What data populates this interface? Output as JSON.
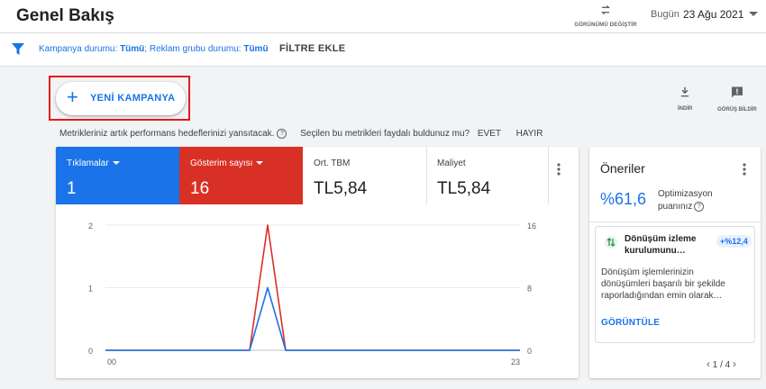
{
  "header": {
    "title": "Genel Bakış",
    "view_toggle_label": "GÖRÜNÜMÜ DEĞİŞTİR",
    "date_label": "Bugün",
    "date_value": "23 Ağu 2021"
  },
  "filters": {
    "campaign_status_label": "Kampanya durumu:",
    "campaign_status_value": "Tümü",
    "adgroup_status_label": "Reklam grubu durumu:",
    "adgroup_status_value": "Tümü",
    "add_filter": "FİLTRE EKLE"
  },
  "actions": {
    "new_campaign": "YENİ KAMPANYA",
    "download": "İNDİR",
    "feedback": "GÖRÜŞ BİLDİR"
  },
  "metrics_note": {
    "text": "Metrikleriniz artık performans hedeflerinizi yansıtacak.",
    "question": "Seçilen bu metrikleri faydalı buldunuz mu?",
    "yes": "EVET",
    "no": "HAYIR"
  },
  "tiles": [
    {
      "label": "Tıklamalar",
      "value": "1",
      "color": "#1a73e8"
    },
    {
      "label": "Gösterim sayısı",
      "value": "16",
      "color": "#d93025"
    },
    {
      "label": "Ort. TBM",
      "value": "TL5,84"
    },
    {
      "label": "Maliyet",
      "value": "TL5,84"
    }
  ],
  "chart_data": {
    "type": "line",
    "x": [
      0,
      1,
      2,
      3,
      4,
      5,
      6,
      7,
      8,
      9,
      10,
      11,
      12,
      13,
      14,
      15,
      16,
      17,
      18,
      19,
      20,
      21,
      22,
      23
    ],
    "x_tick_labels": [
      "00",
      "23"
    ],
    "series": [
      {
        "name": "Tıklamalar",
        "axis": "left",
        "color": "#1a73e8",
        "values": [
          0,
          0,
          0,
          0,
          0,
          0,
          0,
          0,
          0,
          1,
          0,
          0,
          0,
          0,
          0,
          0,
          0,
          0,
          0,
          0,
          0,
          0,
          0,
          0
        ]
      },
      {
        "name": "Gösterim sayısı",
        "axis": "right",
        "color": "#d93025",
        "values": [
          0,
          0,
          0,
          0,
          0,
          0,
          0,
          0,
          0,
          16,
          0,
          0,
          0,
          0,
          0,
          0,
          0,
          0,
          0,
          0,
          0,
          0,
          0,
          0
        ]
      }
    ],
    "left_axis": {
      "ylim": [
        0,
        2
      ],
      "ticks": [
        "0",
        "1",
        "2"
      ]
    },
    "right_axis": {
      "ylim": [
        0,
        16
      ],
      "ticks": [
        "0",
        "8",
        "16"
      ]
    },
    "grid": true,
    "title": "",
    "xlabel": "",
    "ylabel": ""
  },
  "recommendations": {
    "title": "Öneriler",
    "score": "%61,6",
    "score_label": "Optimizasyon puanınız",
    "item_title": "Dönüşüm izleme kurulumunu…",
    "item_badge": "+%12,4",
    "item_desc": "Dönüşüm işlemlerinizin dönüşümleri başarılı bir şekilde raporladığından emin olarak…",
    "item_cta": "GÖRÜNTÜLE",
    "pager": "1 / 4"
  }
}
